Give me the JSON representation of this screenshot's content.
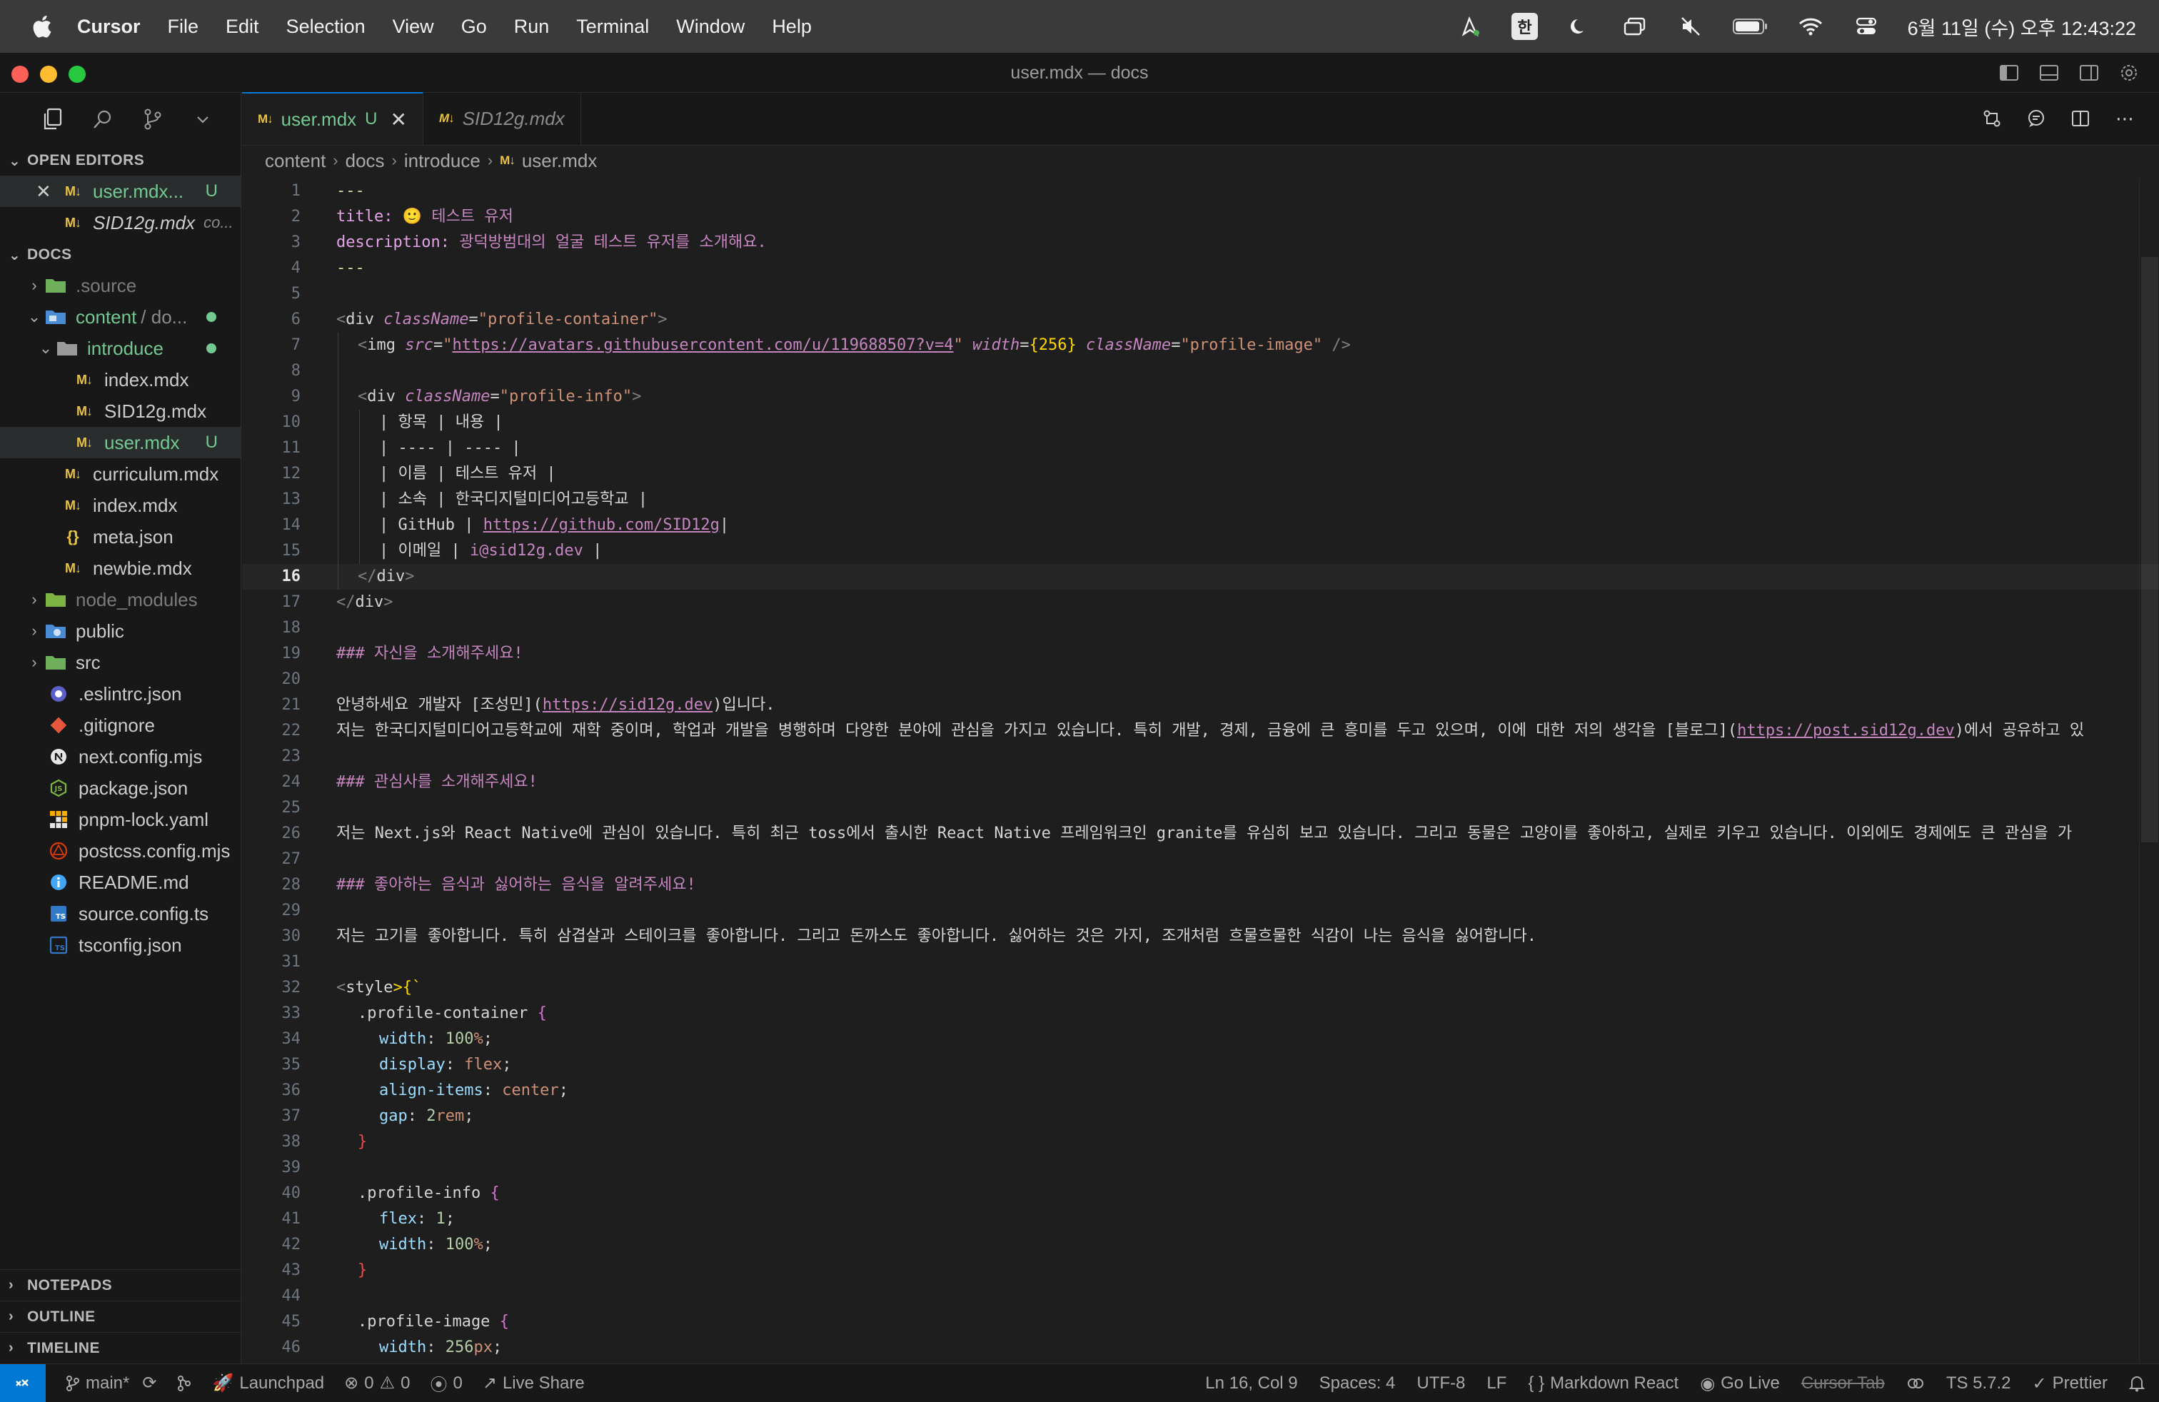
{
  "menubar": {
    "app_name": "Cursor",
    "menus": [
      "File",
      "Edit",
      "Selection",
      "View",
      "Go",
      "Run",
      "Terminal",
      "Window",
      "Help"
    ],
    "ime": "한",
    "clock": "6월 11일 (수) 오후 12:43:22"
  },
  "window": {
    "title": "user.mdx — docs"
  },
  "sidebar": {
    "open_editors_header": "OPEN EDITORS",
    "open_editors": [
      {
        "name": "user.mdx...",
        "badge": "U"
      },
      {
        "name": "SID12g.mdx",
        "suffix": "co..."
      }
    ],
    "docs_header": "DOCS",
    "tree": [
      {
        "name": ".source"
      },
      {
        "name": "content",
        "suffix": "/ do..."
      },
      {
        "name": "introduce"
      },
      {
        "name": "index.mdx"
      },
      {
        "name": "SID12g.mdx"
      },
      {
        "name": "user.mdx",
        "badge": "U"
      },
      {
        "name": "curriculum.mdx"
      },
      {
        "name": "index.mdx"
      },
      {
        "name": "meta.json"
      },
      {
        "name": "newbie.mdx"
      },
      {
        "name": "node_modules"
      },
      {
        "name": "public"
      },
      {
        "name": "src"
      },
      {
        "name": ".eslintrc.json"
      },
      {
        "name": ".gitignore"
      },
      {
        "name": "next.config.mjs"
      },
      {
        "name": "package.json"
      },
      {
        "name": "pnpm-lock.yaml"
      },
      {
        "name": "postcss.config.mjs"
      },
      {
        "name": "README.md"
      },
      {
        "name": "source.config.ts"
      },
      {
        "name": "tsconfig.json"
      }
    ],
    "bottom_sections": [
      "NOTEPADS",
      "OUTLINE",
      "TIMELINE"
    ]
  },
  "tabs": [
    {
      "label": "user.mdx",
      "badge": "U"
    },
    {
      "label": "SID12g.mdx"
    }
  ],
  "breadcrumb": [
    "content",
    "docs",
    "introduce",
    "user.mdx"
  ],
  "editor": {
    "line_numbers": [
      "1",
      "2",
      "3",
      "4",
      "5",
      "6",
      "7",
      "8",
      "9",
      "10",
      "11",
      "12",
      "13",
      "14",
      "15",
      "16",
      "17",
      "18",
      "19",
      "20",
      "21",
      "22",
      "23",
      "24",
      "25",
      "26",
      "27",
      "28",
      "29",
      "30",
      "31",
      "32",
      "33",
      "34",
      "35",
      "36",
      "37",
      "38",
      "39",
      "40",
      "41",
      "42",
      "43",
      "44",
      "45",
      "46"
    ],
    "current_line": "16",
    "code": {
      "l1": "---",
      "l2_key": "title:",
      "l2_val": "🙂 테스트 유저",
      "l3_key": "description:",
      "l3_val": "광덕방범대의 얼굴 테스트 유저를 소개해요.",
      "l4": "---",
      "l6_tag": "div",
      "l6_attr": "className",
      "l6_str": "\"profile-container\"",
      "l7_tag": "img",
      "l7_attr_src": "src",
      "l7_url": "https://avatars.githubusercontent.com/u/119688507?v=4",
      "l7_attr_width": "width",
      "l7_width_val": "{256}",
      "l7_attr_class": "className",
      "l7_class_val": "\"profile-image\"",
      "l9_tag": "div",
      "l9_attr": "className",
      "l9_str": "\"profile-info\"",
      "l10": "| 항목 | 내용 |",
      "l11": "| ---- | ---- |",
      "l12": "| 이름 | 테스트 유저 |",
      "l13": "| 소속 | 한국디지털미디어고등학교 |",
      "l14_pre": "| GitHub | ",
      "l14_url": "https://github.com/SID12g",
      "l15_pre": "| 이메일 | ",
      "l15_mail": "i@sid12g.dev",
      "l15_post": " |",
      "l16_tag": "div",
      "l17_tag": "div",
      "l19": "### 자신을 소개해주세요!",
      "l21_pre": "안녕하세요 개발자 [조성민](",
      "l21_url": "https://sid12g.dev",
      "l21_post": ")입니다.",
      "l22_pre": "저는 한국디지털미디어고등학교에 재학 중이며, 학업과 개발을 병행하며 다양한 분야에 관심을 가지고 있습니다. 특히 개발, 경제, 금융에 큰 흥미를 두고 있으며, 이에 대한 저의 생각을 [블로그](",
      "l22_url": "https://post.sid12g.dev",
      "l22_post": ")에서 공유하고 있",
      "l24": "### 관심사를 소개해주세요!",
      "l26": "저는 Next.js와 React Native에 관심이 있습니다. 특히 최근 toss에서 출시한 React Native 프레임워크인 granite를 유심히 보고 있습니다. 그리고 동물은 고양이를 좋아하고, 실제로 키우고 있습니다. 이외에도 경제에도 큰 관심을 가",
      "l28": "### 좋아하는 음식과 싫어하는 음식을 알려주세요!",
      "l30": "저는 고기를 좋아합니다. 특히 삼겹살과 스테이크를 좋아합니다. 그리고 돈까스도 좋아합니다. 싫어하는 것은 가지, 조개처럼 흐물흐물한 식감이 나는 음식을 싫어합니다.",
      "l32_tag": "style",
      "l32_rest": ">{`",
      "l33_sel": ".profile-container",
      "l34_prop": "width",
      "l34_num": "100",
      "l34_unit": "%",
      "l35_prop": "display",
      "l35_val": "flex",
      "l36_prop": "align-items",
      "l36_val": "center",
      "l37_prop": "gap",
      "l37_num": "2",
      "l37_unit": "rem",
      "l38": "}",
      "l40_sel": ".profile-info",
      "l41_prop": "flex",
      "l41_num": "1",
      "l42_prop": "width",
      "l42_num": "100",
      "l42_unit": "%",
      "l43": "}",
      "l45_sel": ".profile-image",
      "l46_prop": "width",
      "l46_num": "256",
      "l46_unit": "px"
    }
  },
  "statusbar": {
    "branch": "main*",
    "launchpad": "Launchpad",
    "errors": "0",
    "warnings": "0",
    "ports": "0",
    "live_share": "Live Share",
    "position": "Ln 16, Col 9",
    "spaces": "Spaces: 4",
    "encoding": "UTF-8",
    "eol": "LF",
    "language": "Markdown React",
    "go_live": "Go Live",
    "cursor_tab": "Cursor Tab",
    "ts_version": "TS 5.7.2",
    "prettier": "Prettier"
  },
  "colors": {
    "accent": "#0078d4",
    "untracked": "#73c991",
    "markdown_icon": "#e8c344"
  }
}
